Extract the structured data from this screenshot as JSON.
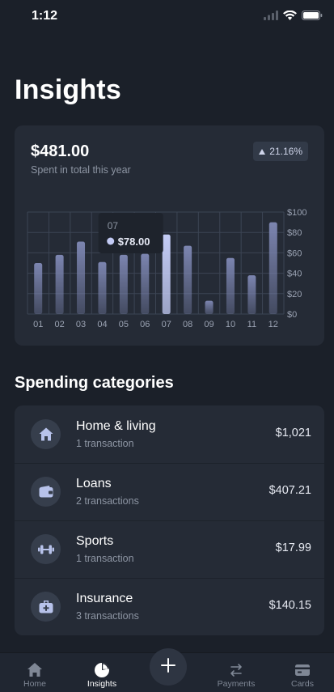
{
  "status_bar": {
    "time": "1:12"
  },
  "page": {
    "title": "Insights"
  },
  "summary": {
    "total": "$481.00",
    "caption": "Spent in total this year",
    "change": "21.16%"
  },
  "chart_data": {
    "type": "bar",
    "categories": [
      "01",
      "02",
      "03",
      "04",
      "05",
      "06",
      "07",
      "08",
      "09",
      "10",
      "11",
      "12"
    ],
    "values": [
      50,
      58,
      71,
      51,
      58,
      59,
      78,
      67,
      13,
      55,
      38,
      90
    ],
    "highlight_index": 6,
    "ylim": [
      0,
      100
    ],
    "y_ticks": [
      "$0",
      "$20",
      "$40",
      "$60",
      "$80",
      "$100"
    ],
    "y_tick_values": [
      0,
      20,
      40,
      60,
      80,
      100
    ],
    "grid": true,
    "tooltip": {
      "label": "07",
      "value": "$78.00"
    },
    "colors": {
      "bar": "#7c85b0",
      "highlight": "#c3cbf5",
      "grid": "#3c4554"
    }
  },
  "categories": {
    "title": "Spending categories",
    "items": [
      {
        "icon": "home-icon",
        "name": "Home & living",
        "count": "1 transaction",
        "amount": "$1,021"
      },
      {
        "icon": "wallet-icon",
        "name": "Loans",
        "count": "2 transactions",
        "amount": "$407.21"
      },
      {
        "icon": "dumbbell-icon",
        "name": "Sports",
        "count": "1 transaction",
        "amount": "$17.99"
      },
      {
        "icon": "medical-bag-icon",
        "name": "Insurance",
        "count": "3 transactions",
        "amount": "$140.15"
      }
    ]
  },
  "tabs": [
    {
      "label": "Home",
      "icon": "home-icon",
      "active": false
    },
    {
      "label": "Insights",
      "icon": "pie-chart-icon",
      "active": true
    },
    {
      "label": "Payments",
      "icon": "transfer-icon",
      "active": false
    },
    {
      "label": "Cards",
      "icon": "card-icon",
      "active": false
    }
  ],
  "colors": {
    "background": "#1b2029",
    "card": "#252b36",
    "accent": "#c3cbf5"
  }
}
